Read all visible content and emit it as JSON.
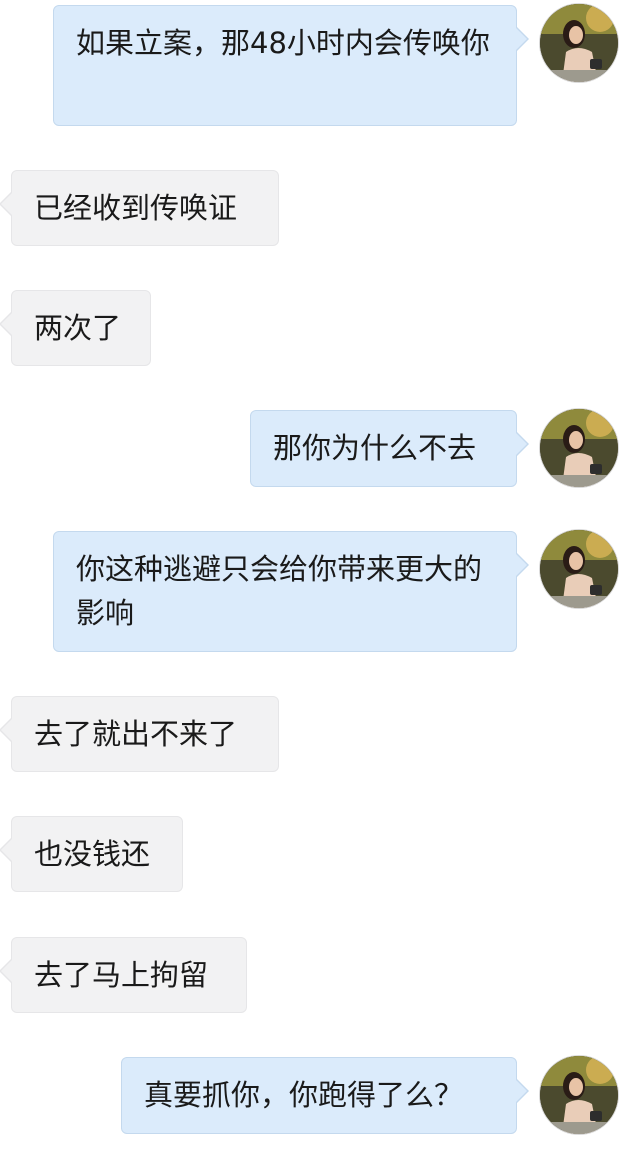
{
  "messages": [
    {
      "side": "right",
      "text": "如果立案，那48小时内会传唤你"
    },
    {
      "side": "left",
      "text": "已经收到传唤证"
    },
    {
      "side": "left",
      "text": "两次了"
    },
    {
      "side": "right",
      "text": "那你为什么不去"
    },
    {
      "side": "right",
      "text": "你这种逃避只会给你带来更大的影响"
    },
    {
      "side": "left",
      "text": "去了就出不来了"
    },
    {
      "side": "left",
      "text": "也没钱还"
    },
    {
      "side": "left",
      "text": "去了马上拘留"
    },
    {
      "side": "right",
      "text": "真要抓你，你跑得了么？"
    }
  ],
  "avatar_icon": "user-avatar-photo",
  "colors": {
    "right_bubble": "#dbebfb",
    "left_bubble": "#f2f2f3",
    "background": "#ffffff"
  }
}
